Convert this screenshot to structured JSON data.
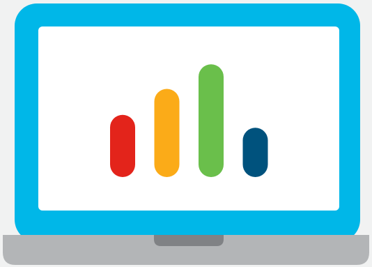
{
  "illustration": {
    "subject": "laptop-with-bar-chart-icon",
    "colors": {
      "background": "#f1f2f2",
      "screen_bezel": "#00b7e8",
      "screen_display": "#ffffff",
      "base": "#b3b5b7",
      "base_notch": "#808285"
    },
    "bars": [
      {
        "name": "red-bar",
        "color": "#e3241b",
        "relative_height": 0.48
      },
      {
        "name": "orange-bar",
        "color": "#fbab18",
        "relative_height": 0.68
      },
      {
        "name": "green-bar",
        "color": "#6abf4b",
        "relative_height": 0.87
      },
      {
        "name": "navy-bar",
        "color": "#00527d",
        "relative_height": 0.38
      }
    ]
  }
}
